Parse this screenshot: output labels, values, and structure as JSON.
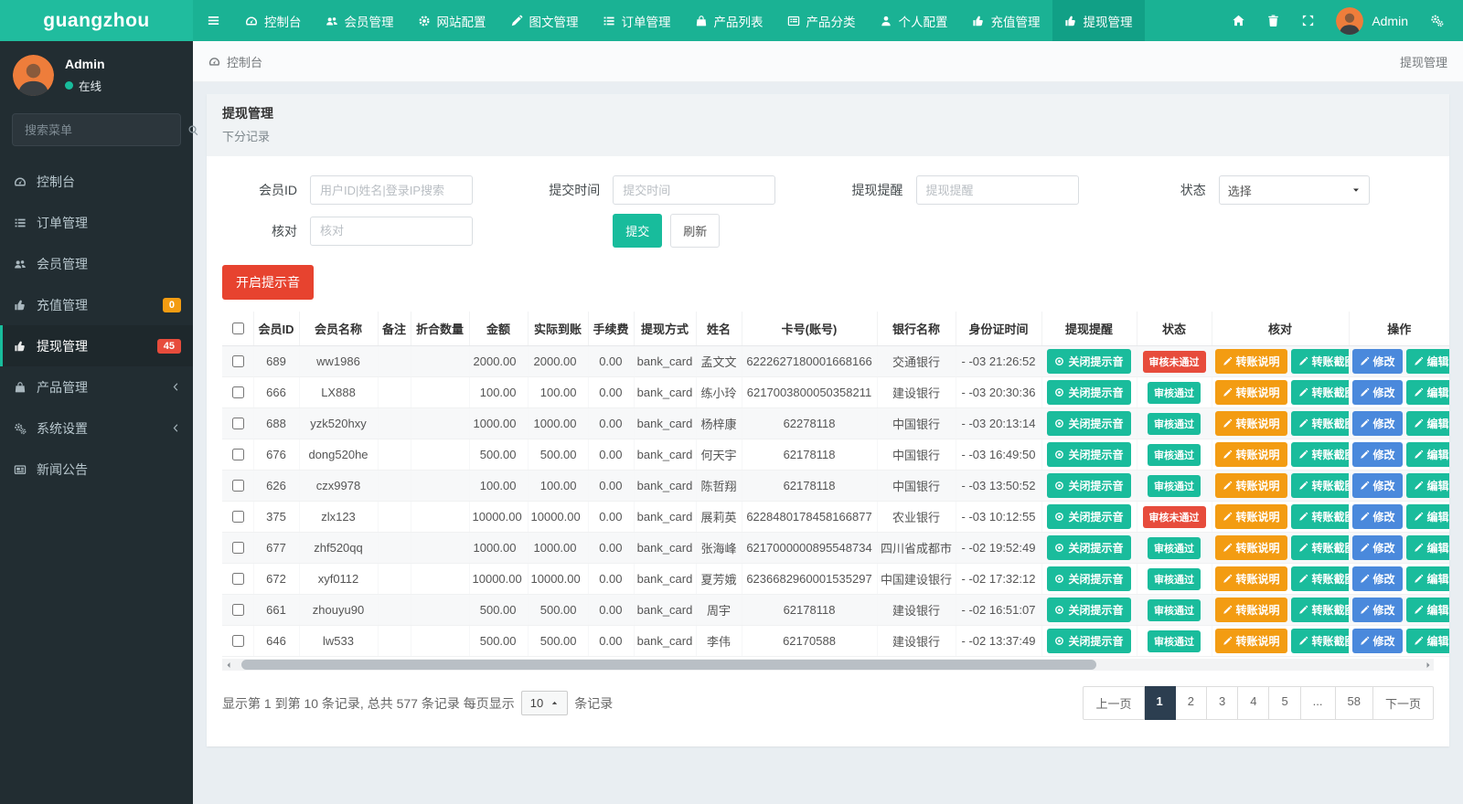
{
  "colors": {
    "teal": "#18bc9c",
    "dark_teal": "#11a086",
    "navbar": "#1ab294",
    "sidebar": "#222d32",
    "red": "#e74c3c",
    "button_red": "#e7432f",
    "orange": "#f39c12",
    "blue": "#4a89dc",
    "navy": "#2c3e50"
  },
  "brand": "guangzhou",
  "topnav": {
    "items": [
      {
        "id": "dashboard",
        "icon": "gauge",
        "label": "控制台"
      },
      {
        "id": "members",
        "icon": "users",
        "label": "会员管理"
      },
      {
        "id": "site-config",
        "icon": "gear",
        "label": "网站配置"
      },
      {
        "id": "content",
        "icon": "pen",
        "label": "图文管理"
      },
      {
        "id": "orders",
        "icon": "list",
        "label": "订单管理"
      },
      {
        "id": "product-list",
        "icon": "bag",
        "label": "产品列表"
      },
      {
        "id": "product-category",
        "icon": "grid",
        "label": "产品分类"
      },
      {
        "id": "profile",
        "icon": "person",
        "label": "个人配置"
      },
      {
        "id": "recharge",
        "icon": "hand",
        "label": "充值管理"
      },
      {
        "id": "withdraw",
        "icon": "hand",
        "label": "提现管理",
        "active": true
      }
    ],
    "user": "Admin"
  },
  "sidebar": {
    "user": {
      "name": "Admin",
      "status": "在线"
    },
    "search_placeholder": "搜索菜单",
    "menu": [
      {
        "id": "dashboard",
        "icon": "gauge",
        "label": "控制台"
      },
      {
        "id": "orders",
        "icon": "list",
        "label": "订单管理"
      },
      {
        "id": "members",
        "icon": "users",
        "label": "会员管理"
      },
      {
        "id": "recharge",
        "icon": "hand",
        "label": "充值管理",
        "badge": "0",
        "badge_color": "#f39c12"
      },
      {
        "id": "withdraw",
        "icon": "hand",
        "label": "提现管理",
        "badge": "45",
        "badge_color": "#e74c3c",
        "active": true
      },
      {
        "id": "products",
        "icon": "bag",
        "label": "产品管理",
        "chevron": true
      },
      {
        "id": "settings",
        "icon": "gears",
        "label": "系统设置",
        "chevron": true
      },
      {
        "id": "news",
        "icon": "news",
        "label": "新闻公告"
      }
    ]
  },
  "breadcrumb": {
    "left": "控制台",
    "right": "提现管理"
  },
  "panel": {
    "title": "提现管理",
    "subtitle": "下分记录"
  },
  "filters": {
    "member_id": {
      "label": "会员ID",
      "placeholder": "用户ID|姓名|登录IP搜索"
    },
    "submit_time": {
      "label": "提交时间",
      "placeholder": "提交时间"
    },
    "withdraw_remind": {
      "label": "提现提醒",
      "placeholder": "提现提醒"
    },
    "status": {
      "label": "状态",
      "value": "选择"
    },
    "check": {
      "label": "核对",
      "placeholder": "核对"
    },
    "submit_label": "提交",
    "refresh_label": "刷新"
  },
  "sound_button_label": "开启提示音",
  "table": {
    "columns": [
      "",
      "会员ID",
      "会员名称",
      "备注",
      "折合数量",
      "金额",
      "实际到账",
      "手续费",
      "提现方式",
      "姓名",
      "卡号(账号)",
      "银行名称",
      "身份证时间",
      "提现提醒",
      "状态",
      "核对",
      "操作"
    ],
    "buttons": {
      "remind": "关闭提示音",
      "note": "转账说明",
      "screenshot": "转账截图",
      "modify": "修改",
      "edit": "编辑"
    },
    "status_labels": {
      "pass": "审核通过",
      "fail": "审核未通过"
    },
    "rows": [
      {
        "id": "689",
        "name": "ww1986",
        "remark": "",
        "qty": "",
        "amount": "2000.00",
        "actual": "2000.00",
        "fee": "0.00",
        "method": "bank_card",
        "realname": "孟文文",
        "card": "6222627180001668166",
        "bank": "交通银行",
        "time": "- -03 21:26:52",
        "status": "fail"
      },
      {
        "id": "666",
        "name": "LX888",
        "remark": "",
        "qty": "",
        "amount": "100.00",
        "actual": "100.00",
        "fee": "0.00",
        "method": "bank_card",
        "realname": "练小玲",
        "card": "6217003800050358211",
        "bank": "建设银行",
        "time": "- -03 20:30:36",
        "status": "pass"
      },
      {
        "id": "688",
        "name": "yzk520hxy",
        "remark": "",
        "qty": "",
        "amount": "1000.00",
        "actual": "1000.00",
        "fee": "0.00",
        "method": "bank_card",
        "realname": "杨梓康",
        "card": "62278118",
        "bank": "中国银行",
        "time": "- -03 20:13:14",
        "status": "pass"
      },
      {
        "id": "676",
        "name": "dong520he",
        "remark": "",
        "qty": "",
        "amount": "500.00",
        "actual": "500.00",
        "fee": "0.00",
        "method": "bank_card",
        "realname": "何天宇",
        "card": "62178118",
        "bank": "中国银行",
        "time": "- -03 16:49:50",
        "status": "pass"
      },
      {
        "id": "626",
        "name": "czx9978",
        "remark": "",
        "qty": "",
        "amount": "100.00",
        "actual": "100.00",
        "fee": "0.00",
        "method": "bank_card",
        "realname": "陈哲翔",
        "card": "62178118",
        "bank": "中国银行",
        "time": "- -03 13:50:52",
        "status": "pass"
      },
      {
        "id": "375",
        "name": "zlx123",
        "remark": "",
        "qty": "",
        "amount": "10000.00",
        "actual": "10000.00",
        "fee": "0.00",
        "method": "bank_card",
        "realname": "展莉英",
        "card": "6228480178458166877",
        "bank": "农业银行",
        "time": "- -03 10:12:55",
        "status": "fail"
      },
      {
        "id": "677",
        "name": "zhf520qq",
        "remark": "",
        "qty": "",
        "amount": "1000.00",
        "actual": "1000.00",
        "fee": "0.00",
        "method": "bank_card",
        "realname": "张海峰",
        "card": "6217000000895548734",
        "bank": "四川省成都市",
        "time": "- -02 19:52:49",
        "status": "pass"
      },
      {
        "id": "672",
        "name": "xyf0112",
        "remark": "",
        "qty": "",
        "amount": "10000.00",
        "actual": "10000.00",
        "fee": "0.00",
        "method": "bank_card",
        "realname": "夏芳娥",
        "card": "6236682960001535297",
        "bank": "中国建设银行",
        "time": "- -02 17:32:12",
        "status": "pass"
      },
      {
        "id": "661",
        "name": "zhouyu90",
        "remark": "",
        "qty": "",
        "amount": "500.00",
        "actual": "500.00",
        "fee": "0.00",
        "method": "bank_card",
        "realname": "周宇",
        "card": "62178118",
        "bank": "建设银行",
        "time": "- -02 16:51:07",
        "status": "pass"
      },
      {
        "id": "646",
        "name": "lw533",
        "remark": "",
        "qty": "",
        "amount": "500.00",
        "actual": "500.00",
        "fee": "0.00",
        "method": "bank_card",
        "realname": "李伟",
        "card": "62170588",
        "bank": "建设银行",
        "time": "- -02 13:37:49",
        "status": "pass"
      }
    ]
  },
  "pagination": {
    "info_prefix": "显示第 1 到第 10 条记录, 总共 577 条记录 每页显示",
    "page_size": "10",
    "info_suffix": "条记录",
    "prev": "上一页",
    "next": "下一页",
    "pages": [
      "1",
      "2",
      "3",
      "4",
      "5",
      "...",
      "58"
    ],
    "active_page": "1"
  }
}
